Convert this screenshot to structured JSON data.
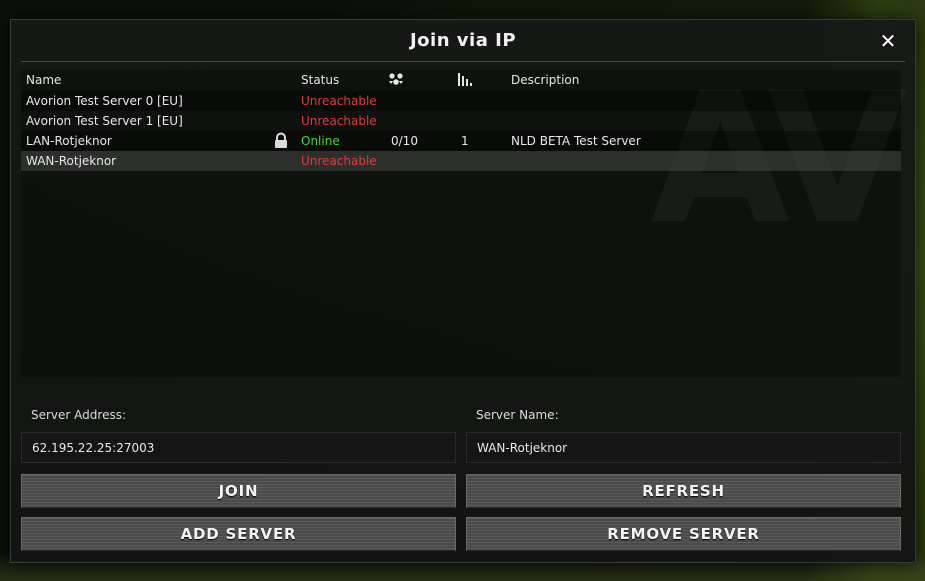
{
  "dialog": {
    "title": "Join via IP",
    "close_label": "✕"
  },
  "table": {
    "headers": {
      "name": "Name",
      "status": "Status",
      "description": "Description"
    },
    "header_icons": [
      "players-icon",
      "ping-bars-icon"
    ],
    "watermark": "AV",
    "rows": [
      {
        "name": "Avorion Test Server 0 [EU]",
        "locked": false,
        "status": "Unreachable",
        "players": "",
        "ping": "",
        "description": ""
      },
      {
        "name": "Avorion Test Server 1 [EU]",
        "locked": false,
        "status": "Unreachable",
        "players": "",
        "ping": "",
        "description": ""
      },
      {
        "name": "LAN-Rotjeknor",
        "locked": true,
        "status": "Online",
        "players": "0/10",
        "ping": "1",
        "description": "NLD BETA Test Server"
      },
      {
        "name": "WAN-Rotjeknor",
        "locked": false,
        "status": "Unreachable",
        "players": "",
        "ping": "",
        "description": ""
      }
    ],
    "selected_row": 3
  },
  "form": {
    "address_label": "Server Address:",
    "address_value": "62.195.22.25:27003",
    "name_label": "Server Name:",
    "name_value": "WAN-Rotjeknor"
  },
  "buttons": {
    "join": "JOIN",
    "refresh": "REFRESH",
    "add": "ADD SERVER",
    "remove": "REMOVE SERVER"
  },
  "colors": {
    "unreachable": "#e23b3b",
    "online": "#3fd64a",
    "panel": "#161816"
  }
}
